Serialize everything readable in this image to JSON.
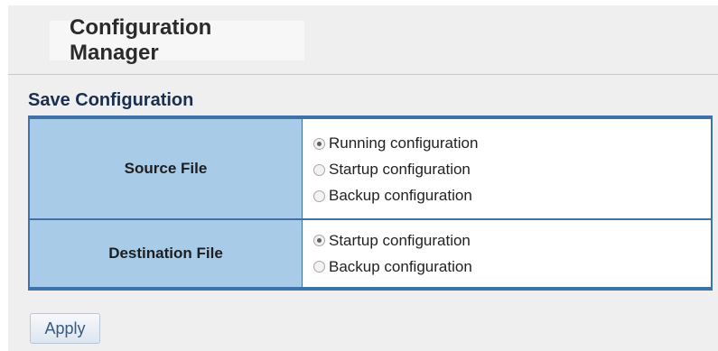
{
  "page": {
    "title": "Configuration Manager",
    "section_title": "Save Configuration"
  },
  "form": {
    "source_file": {
      "label": "Source File",
      "options": [
        {
          "label": "Running configuration",
          "checked": true
        },
        {
          "label": "Startup configuration",
          "checked": false
        },
        {
          "label": "Backup configuration",
          "checked": false
        }
      ]
    },
    "destination_file": {
      "label": "Destination File",
      "options": [
        {
          "label": "Startup configuration",
          "checked": true
        },
        {
          "label": "Backup configuration",
          "checked": false
        }
      ]
    }
  },
  "actions": {
    "apply_label": "Apply"
  },
  "colors": {
    "table_border": "#3f72a8",
    "label_cell_bg": "#a8cbe8",
    "page_bg": "#efefef"
  }
}
